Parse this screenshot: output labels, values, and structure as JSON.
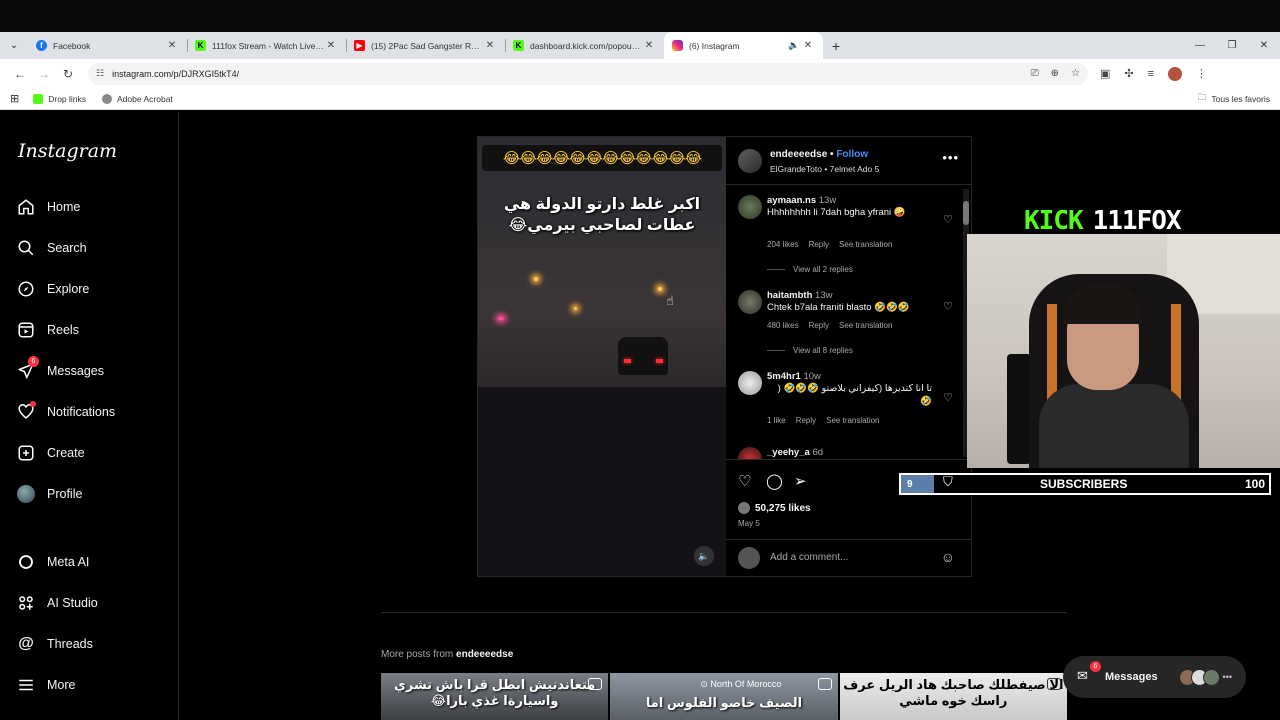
{
  "browser": {
    "tabs": [
      {
        "title": "Facebook",
        "icon": "facebook-icon",
        "color": "#1877f2"
      },
      {
        "title": "111fox Stream - Watch Live on",
        "icon": "kick-icon",
        "color": "#53fc18"
      },
      {
        "title": "(15) 2Pac Sad Gangster Rap Mi",
        "icon": "youtube-icon",
        "color": "#ff0000"
      },
      {
        "title": "dashboard.kick.com/popout/11",
        "icon": "kick-icon",
        "color": "#53fc18"
      },
      {
        "title": "(6) Instagram",
        "icon": "instagram-icon",
        "color": "#e1306c"
      }
    ],
    "url": "instagram.com/p/DJRXGI5tkT4/",
    "bookmarks": [
      {
        "label": "Drop links"
      },
      {
        "label": "Adobe Acrobat"
      }
    ],
    "bookmarks_right": "Tous les favoris"
  },
  "instagram": {
    "logo": "Instagram",
    "nav": [
      {
        "label": "Home",
        "icon": "home-icon"
      },
      {
        "label": "Search",
        "icon": "search-icon"
      },
      {
        "label": "Explore",
        "icon": "compass-icon"
      },
      {
        "label": "Reels",
        "icon": "reels-icon"
      },
      {
        "label": "Messages",
        "icon": "messages-icon",
        "badge": "6"
      },
      {
        "label": "Notifications",
        "icon": "heart-icon"
      },
      {
        "label": "Create",
        "icon": "plus-square-icon"
      },
      {
        "label": "Profile",
        "icon": "profile-avatar"
      },
      {
        "label": "Meta AI",
        "icon": "meta-ai-icon"
      },
      {
        "label": "AI Studio",
        "icon": "ai-studio-icon"
      },
      {
        "label": "Threads",
        "icon": "threads-icon"
      },
      {
        "label": "More",
        "icon": "menu-icon"
      }
    ],
    "post": {
      "emoji_row": "😂😂😂😂😂😂😂😂😂😂😂😂",
      "caption_line1": "اكبر غلط دارتو الدولة هي",
      "caption_line2": "عطات لصاحبي بيرمي😂",
      "username": "endeeeedse",
      "follow": "Follow",
      "subline": "ElGrandeToto • 7elmet Ado 5",
      "comments": [
        {
          "user": "aymaan.ns",
          "time": "13w",
          "text": "Hhhhhhhh li 7dah bgha yfrani 🤪",
          "likes": "204 likes",
          "reply": "Reply",
          "translate": "See translation",
          "replies": "View all 2 replies"
        },
        {
          "user": "haitambth",
          "time": "13w",
          "text": "Chtek b7ala franiti blasto 🤣🤣🤣",
          "likes": "480 likes",
          "reply": "Reply",
          "translate": "See translation",
          "replies": "View all 8 replies"
        },
        {
          "user": "5m4hr1",
          "time": "10w",
          "text": "تا انا كنديرها (كيفراني بلاصتو 🤣🤣🤣 ( 🤣",
          "likes": "1 like",
          "reply": "Reply",
          "translate": "See translation"
        },
        {
          "user": "_yeehy_a",
          "time": "6d"
        }
      ],
      "like_count": "50,275 likes",
      "date": "May 5",
      "add_comment_placeholder": "Add a comment..."
    },
    "more_posts_prefix": "More posts from",
    "more_posts_user": "endeeeedse",
    "thumbs": [
      {
        "text": "متعاندنيش ابطل قرا باش تشري واسيارةا غذي بارا😂"
      },
      {
        "location": "North Of Morocco",
        "text": "الصيف خاصو الفلوس اما"
      },
      {
        "text": "الا صيفطلك صاحبك هاد الريل عرف راسك خوه ماشي"
      }
    ],
    "messages_pill": {
      "label": "Messages",
      "badge": "6"
    }
  },
  "stream_overlay": {
    "kick_word": "KICK",
    "channel": "111FOX",
    "subs_current": "9",
    "subs_label": "SUBSCRIBERS",
    "subs_goal": "100",
    "subs_progress": 0.09,
    "accent_color": "#53fc18"
  }
}
